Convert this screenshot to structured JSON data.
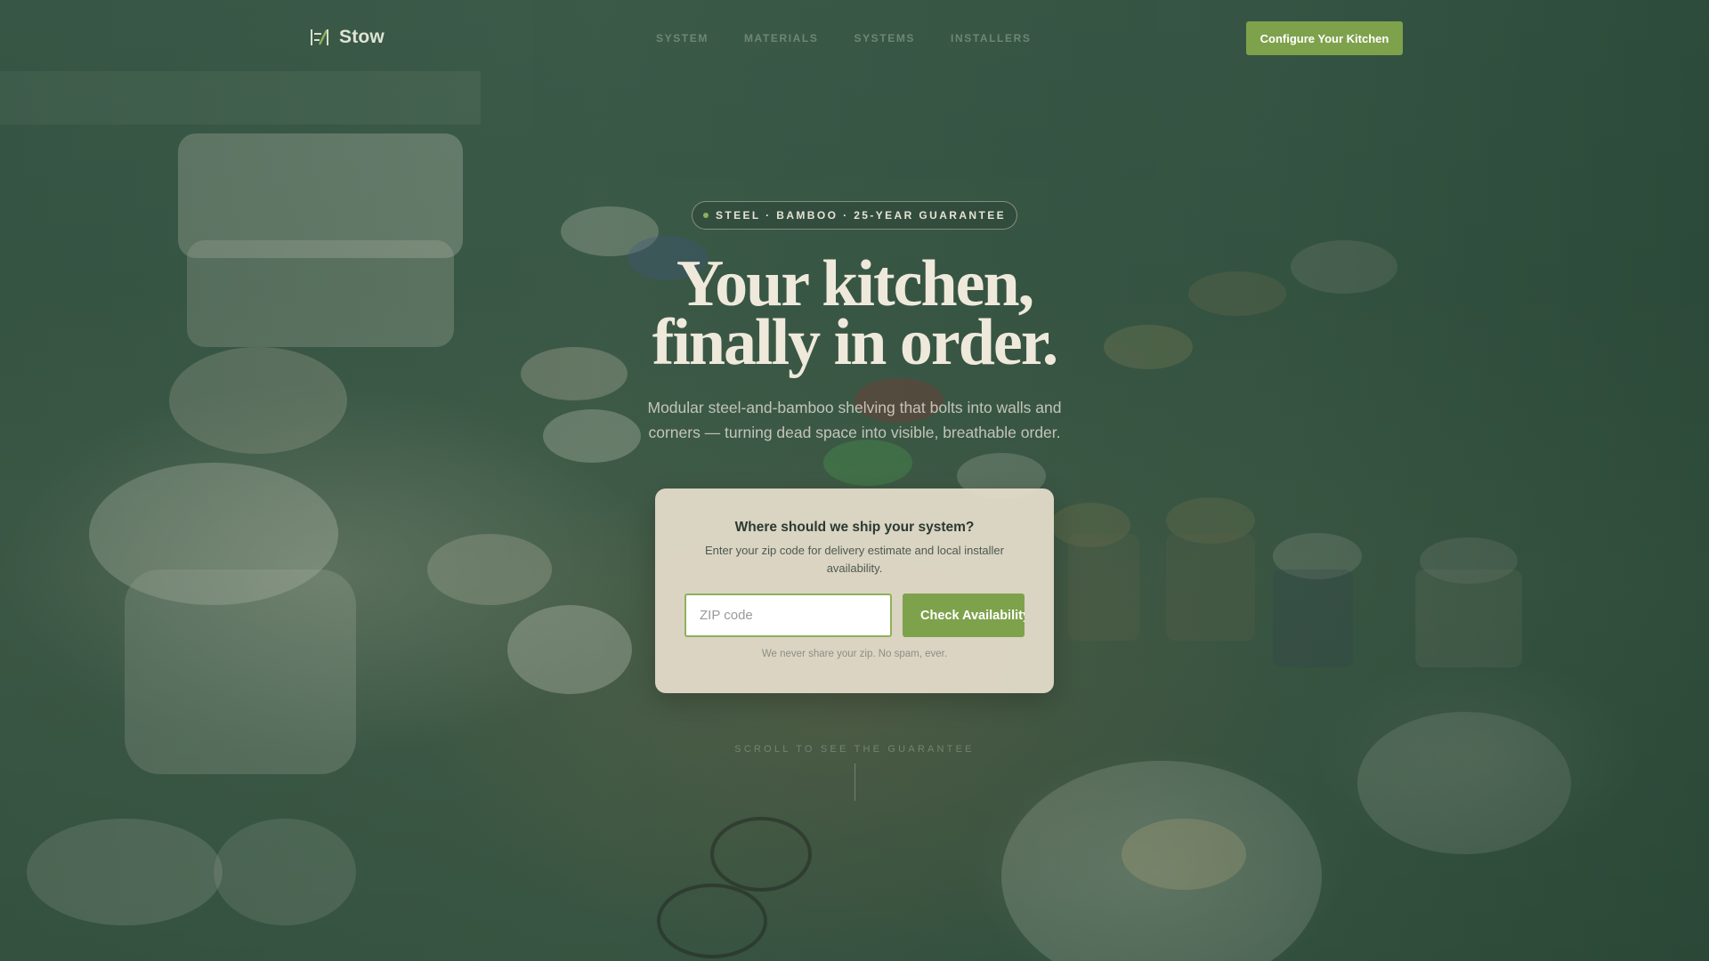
{
  "brand": {
    "name": "Stow",
    "logo_icon": "shelf-logo-icon"
  },
  "nav": {
    "links": [
      {
        "label": "SYSTEM"
      },
      {
        "label": "MATERIALS"
      },
      {
        "label": "SYSTEMS"
      },
      {
        "label": "INSTALLERS"
      }
    ],
    "cta_label": "Configure Your Kitchen"
  },
  "hero": {
    "badge": "STEEL · BAMBOO · 25-YEAR GUARANTEE",
    "headline_line1": "Your kitchen,",
    "headline_line2": "finally in order.",
    "subhead": "Modular steel-and-bamboo shelving that bolts into walls and corners — turning dead space into visible, breathable order."
  },
  "zip_card": {
    "title": "Where should we ship your system?",
    "description": "Enter your zip code for delivery estimate and local installer availability.",
    "input_value": "",
    "input_placeholder": "ZIP code",
    "button_label": "Check Availability",
    "note": "We never share your zip. No spam, ever."
  },
  "scroll_hint": "SCROLL TO SEE THE GUARANTEE",
  "colors": {
    "accent": "#7ea24c",
    "overlay": "#3d5b48",
    "card_bg": "#e6dec9"
  }
}
